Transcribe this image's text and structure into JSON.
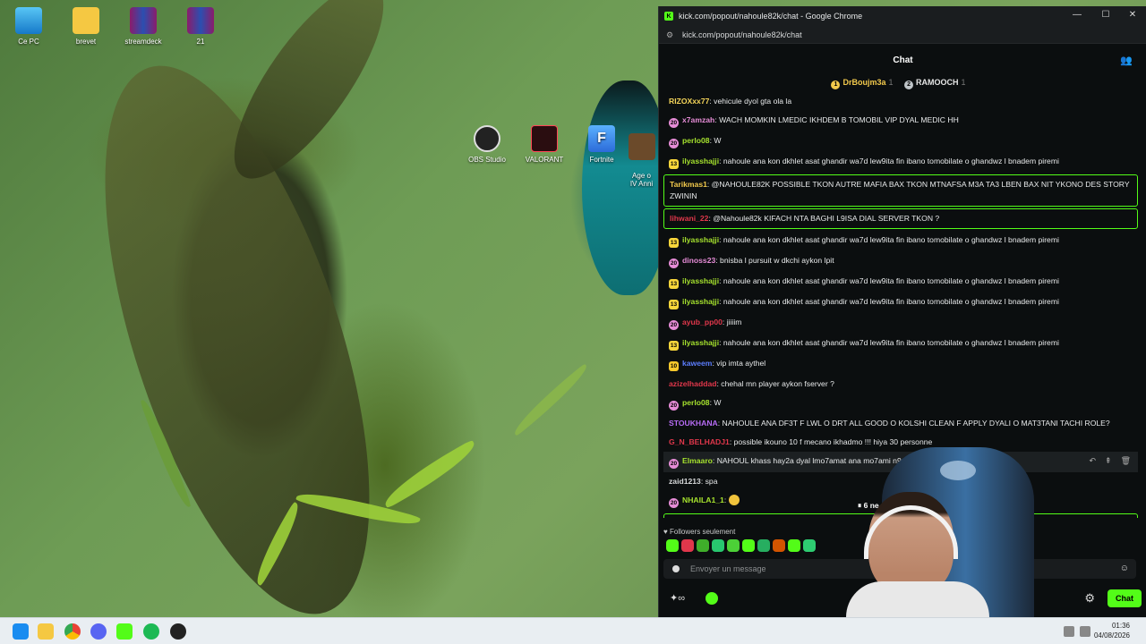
{
  "desktop": {
    "icons": [
      {
        "label": "Ce PC",
        "icon": "monitor-icon"
      },
      {
        "label": "brevet",
        "icon": "folder-icon"
      },
      {
        "label": "streamdeck",
        "icon": "winrar-icon"
      },
      {
        "label": "21",
        "icon": "winrar-icon"
      },
      {
        "label": "OBS Studio",
        "icon": "obs-icon"
      },
      {
        "label": "VALORANT",
        "icon": "valorant-icon"
      },
      {
        "label": "Fortnite",
        "icon": "fortnite-icon"
      },
      {
        "label": "Age o\nIV Anni",
        "icon": "game-icon"
      }
    ]
  },
  "window": {
    "title": "kick.com/popout/nahoule82k/chat - Google Chrome",
    "url": "kick.com/popout/nahoule82k/chat",
    "controls": [
      "—",
      "☐",
      "✕"
    ]
  },
  "chat": {
    "header": "Chat",
    "leaderboard": [
      {
        "rank": "1",
        "name": "DrBoujm3a",
        "count": "1",
        "color": "#f2c94c"
      },
      {
        "rank": "2",
        "name": "RAMOOCH",
        "count": "1",
        "color": "#bfc5c9"
      }
    ],
    "messages": [
      {
        "badge": "",
        "user": "RIZOXxx77",
        "color": "#f6d65a",
        "text": "vehicule dyol gta ola la"
      },
      {
        "badge": "sub",
        "user": "x7amzah",
        "color": "#e58cd6",
        "text": "WACH MOMKIN LMEDIC IKHDEM B TOMOBIL VIP DYAL MEDIC HH"
      },
      {
        "badge": "sub",
        "user": "perlo08",
        "color": "#a6e22e",
        "text": "W"
      },
      {
        "badge": "gift13",
        "user": "ilyasshajji",
        "color": "#a6e22e",
        "text": "nahoule ana kon dkhlet asat ghandir wa7d lew9ita fin ibano tomobilate o ghandwz l bnadem piremi"
      },
      {
        "badge": "",
        "user": "Tarikmas1",
        "color": "#f2c94c",
        "text": "@NAHOULE82K POSSIBLE TKON AUTRE MAFIA BAX TKON MTNAFSA M3A TA3 LBEN BAX NIT YKONO DES STORY ZWININ",
        "highlight": true
      },
      {
        "badge": "",
        "user": "lihwani_22",
        "color": "#e0374b",
        "text": "@Nahoule82k KIFACH NTA BAGHI L9ISA DIAL SERVER TKON ?",
        "highlight": true
      },
      {
        "badge": "gift13",
        "user": "ilyasshajji",
        "color": "#a6e22e",
        "text": "nahoule ana kon dkhlet asat ghandir wa7d lew9ita fin ibano tomobilate o ghandwz l bnadem piremi"
      },
      {
        "badge": "sub",
        "user": "dinoss23",
        "color": "#e58cd6",
        "text": "bnisba l pursuit w dkchi aykon lpit"
      },
      {
        "badge": "gift13",
        "user": "ilyasshajji",
        "color": "#a6e22e",
        "text": "nahoule ana kon dkhlet asat ghandir wa7d lew9ita fin ibano tomobilate o ghandwz l bnadem piremi"
      },
      {
        "badge": "gift13",
        "user": "ilyasshajji",
        "color": "#a6e22e",
        "text": "nahoule ana kon dkhlet asat ghandir wa7d lew9ita fin ibano tomobilate o ghandwz l bnadem piremi"
      },
      {
        "badge": "sub",
        "user": "ayub_pp00",
        "color": "#e0374b",
        "text": "jiiiim"
      },
      {
        "badge": "gift13",
        "user": "ilyasshajji",
        "color": "#a6e22e",
        "text": "nahoule ana kon dkhlet asat ghandir wa7d lew9ita fin ibano tomobilate o ghandwz l bnadem piremi"
      },
      {
        "badge": "vip10",
        "user": "kaweem",
        "color": "#5b7cfa",
        "text": "vip imta aythel"
      },
      {
        "badge": "",
        "user": "azizelhaddad",
        "color": "#e0374b",
        "text": "chehal mn player aykon fserver ?"
      },
      {
        "badge": "sub",
        "user": "perlo08",
        "color": "#a6e22e",
        "text": "W"
      },
      {
        "badge": "",
        "user": "STOUKHANA",
        "color": "#b76cf5",
        "text": "NAHOULE ANA DF3T F LWL O DRT ALL GOOD O KOLSHI CLEAN F APPLY DYALI O MAT3TANI TACHI ROLE?"
      },
      {
        "badge": "",
        "user": "G_N_BELHADJ1",
        "color": "#e0374b",
        "text": "possible ikouno 10 f mecano ikhadmo !!! hiya 30 personne"
      },
      {
        "badge": "sub",
        "user": "Elmaaro",
        "color": "#a6e22e",
        "text": "NAHOUL khass hay2a dyal lmo7amat ana mo7ami n9dar nhzha l hiba",
        "hover": true
      },
      {
        "badge": "",
        "user": "zaid1213",
        "color": "#d6d8d9",
        "text": "spa"
      },
      {
        "badge": "sub",
        "user": "NHAILA1_1",
        "color": "#a6e22e",
        "text": "",
        "emote": true
      },
      {
        "badge": "",
        "user": "lihwani_22",
        "color": "#e0374b",
        "text": "@Nahoule82k KIFACH NTA BAGHI L9ISA DIAL SERVER TKON ?",
        "highlight": true
      }
    ],
    "paused_label": "6 ne",
    "followers_only": "Followers seulement",
    "input_placeholder": "Envoyer un message",
    "send_label": "Chat",
    "message_actions": [
      "reply-icon",
      "pin-icon",
      "delete-icon"
    ]
  },
  "taskbar": {
    "time": "01:36",
    "date": "04/08/2026",
    "apps": [
      "windows-start-icon",
      "file-explorer-icon",
      "chrome-icon",
      "discord-icon",
      "kick-icon",
      "spotify-icon",
      "app-icon"
    ]
  },
  "colors": {
    "accent": "#53fc18",
    "chat_bg": "#0b0e0f"
  }
}
